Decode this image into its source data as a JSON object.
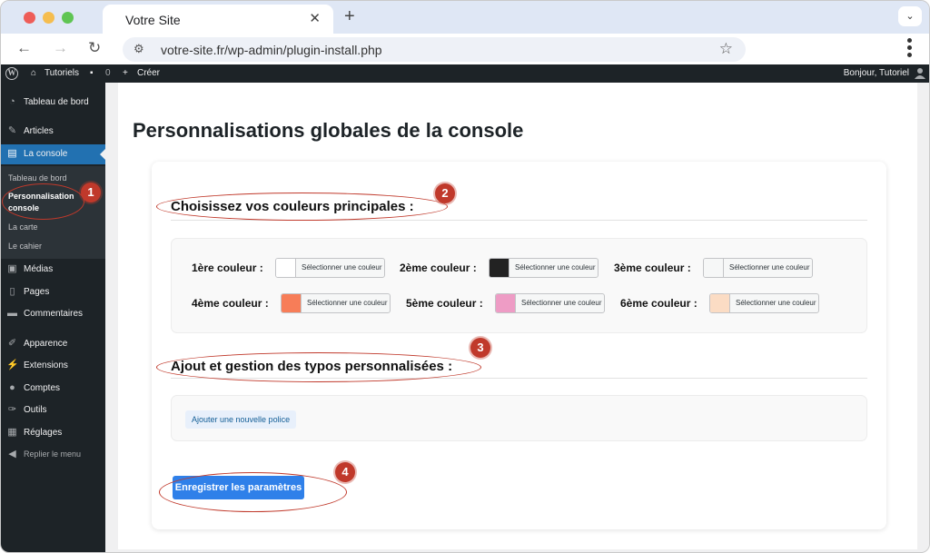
{
  "browser": {
    "tab_title": "Votre Site",
    "url": "votre-site.fr/wp-admin/plugin-install.php",
    "icons": {
      "close": "close-icon",
      "new_tab": "plus-icon",
      "menu": "chevron-down-icon"
    }
  },
  "adminbar": {
    "site_name": "Tutoriels",
    "comments_count": "0",
    "new_label": "Créer",
    "greeting": "Bonjour, Tutoriel"
  },
  "sidebar": {
    "items": [
      {
        "label": "Tableau de bord",
        "icon": "dashboard-icon"
      },
      {
        "label": "Articles",
        "icon": "pin-icon"
      },
      {
        "label": "La console",
        "icon": "console-icon",
        "active": true
      },
      {
        "label": "Médias",
        "icon": "media-icon"
      },
      {
        "label": "Pages",
        "icon": "page-icon"
      },
      {
        "label": "Commentaires",
        "icon": "comment-icon"
      },
      {
        "label": "Apparence",
        "icon": "brush-icon"
      },
      {
        "label": "Extensions",
        "icon": "plugin-icon"
      },
      {
        "label": "Comptes",
        "icon": "user-icon"
      },
      {
        "label": "Outils",
        "icon": "wrench-icon"
      },
      {
        "label": "Réglages",
        "icon": "settings-icon"
      },
      {
        "label": "Replier le menu",
        "icon": "collapse-icon"
      }
    ],
    "submenu": [
      {
        "label": "Tableau de bord"
      },
      {
        "label": "Personnalisation console",
        "current": true
      },
      {
        "label": "La carte"
      },
      {
        "label": "Le cahier"
      }
    ]
  },
  "page": {
    "title": "Personnalisations globales de la console",
    "colors_title": "Choisissez vos couleurs principales :",
    "fonts_title": "Ajout et gestion des typos personnalisées :",
    "picker_label": "Sélectionner une couleur",
    "color_fields": [
      {
        "label": "1ère couleur :",
        "color": "#ffffff"
      },
      {
        "label": "2ème couleur :",
        "color": "#222222"
      },
      {
        "label": "3ème couleur :",
        "color": "#f6f7f7"
      },
      {
        "label": "4ème couleur :",
        "color": "#f77d58"
      },
      {
        "label": "5ème couleur :",
        "color": "#ee9cc5"
      },
      {
        "label": "6ème couleur :",
        "color": "#fbdcc4"
      }
    ],
    "add_font_label": "Ajouter une nouvelle police",
    "save_label": "Enregistrer les paramètres"
  },
  "annotations": [
    "1",
    "2",
    "3",
    "4"
  ],
  "colors": {
    "accent": "#2271b1",
    "annotation": "#c0392b",
    "primary_button": "#2f80e9"
  }
}
